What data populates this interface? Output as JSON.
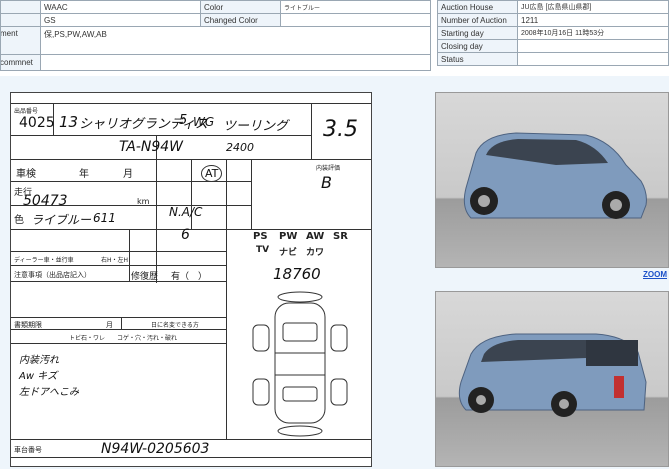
{
  "vehicle_info": {
    "grade_value": "WAAC",
    "color_label": "Color",
    "color_value": "ライトブルー",
    "grade2_value": "GS",
    "changed_color_label": "Changed Color",
    "equipment_label": "ment",
    "equipment_value": "保,PS,PW,AW,AB",
    "comment_label": "commnet"
  },
  "auction_info": {
    "rows": [
      {
        "label": "Auction House",
        "value": "JU広島 [広島県山県郡]"
      },
      {
        "label": "Number of Auction",
        "value": "1211"
      },
      {
        "label": "Starting day",
        "value": "2008年10月16日 11時53分"
      },
      {
        "label": "Closing day",
        "value": ""
      },
      {
        "label": "Status",
        "value": ""
      }
    ]
  },
  "sheet": {
    "lot_number": "4025",
    "year": "13",
    "model_name": "シャリオグランディス",
    "doors": "5",
    "trans_type": "WG",
    "grade": "ツーリング",
    "score": "3.5",
    "chassis_code": "TA-N94W",
    "displacement": "2400",
    "shaken_label": "車検",
    "year_label": "年",
    "month_label": "月",
    "mileage_label": "走行",
    "mileage": "50473",
    "km_label": "km",
    "color_label": "色",
    "color": "ライブルー",
    "color_code": "611",
    "transmission": "AT",
    "aircon": "N.A/C",
    "seats": "6",
    "notes_label": "注意事項（出品店記入）",
    "repair_label": "修復歴",
    "repair_value": "有（　）",
    "equip_ps": "PS",
    "equip_pw": "PW",
    "equip_aw": "AW",
    "equip_sr": "SR",
    "equip_tv": "TV",
    "equip_navi": "ナビ",
    "equip_kawa": "カワ",
    "price": "18760",
    "docs_label": "書類期限",
    "docs_month": "月",
    "docs_note": "日に名変できる方",
    "inspector_notes": [
      "内装汚れ",
      "Aw キズ",
      "左ドアへこみ"
    ],
    "condition_labels": "トビ石・ワレ　　コゲ・穴・汚れ・破れ",
    "frame_label": "車台番号",
    "frame_number": "N94W-0205603",
    "dealer_label": "ディーラー車・並行車",
    "handle_label": "右H・左H",
    "history_label": "内装評価",
    "interior_score": "B"
  },
  "photos": {
    "zoom_label": "ZOOM"
  }
}
